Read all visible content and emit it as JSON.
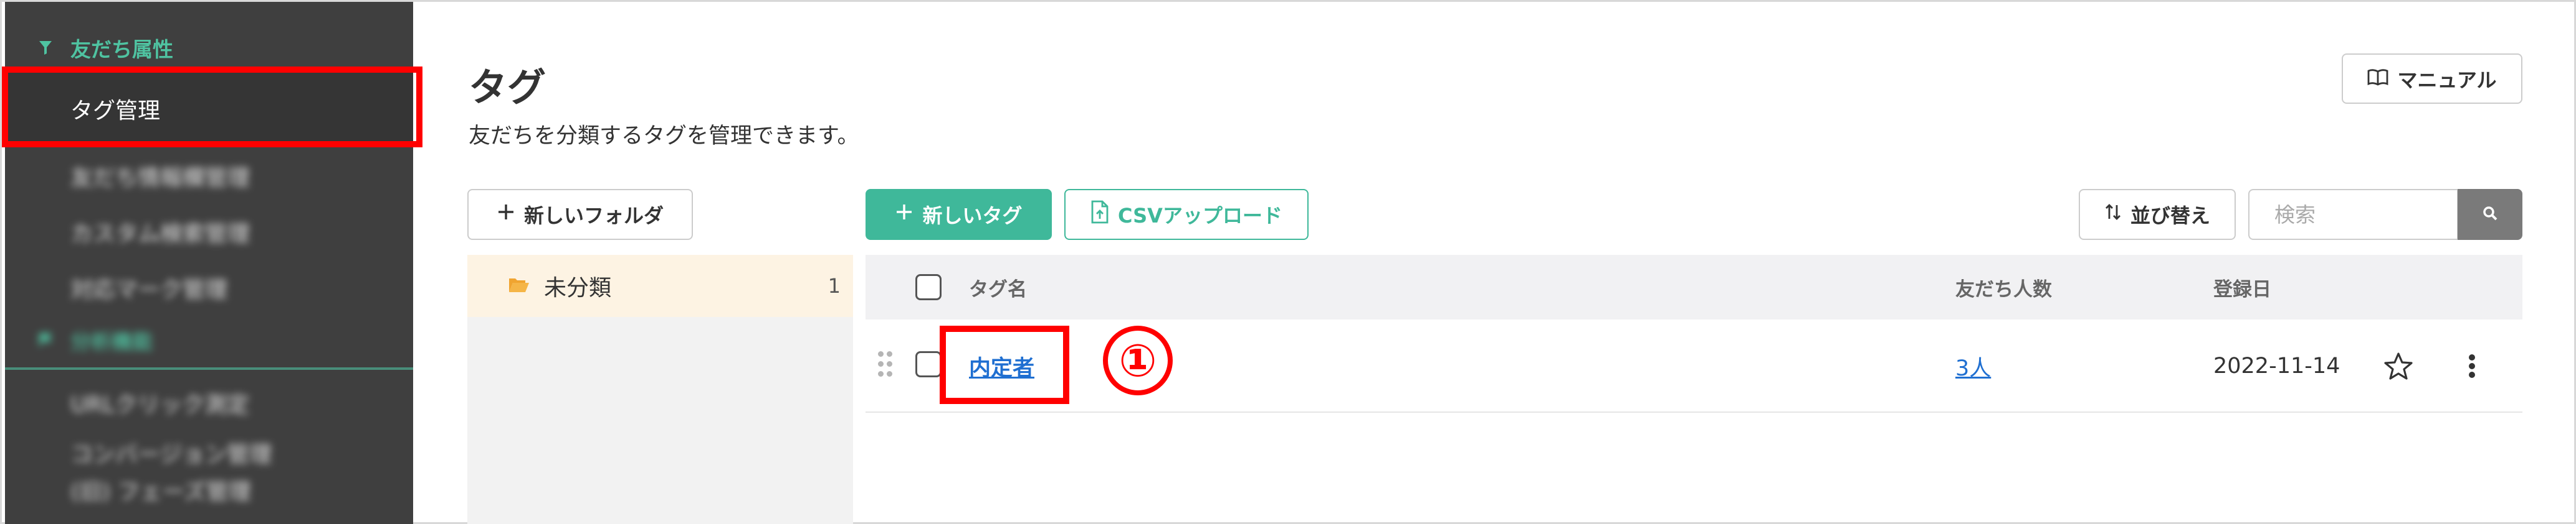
{
  "sidebar": {
    "section1_label": "友だち属性",
    "active_item": "タグ管理",
    "blurred_items": [
      "友だち情報欄管理",
      "カスタム検索管理",
      "対応マーク管理"
    ],
    "section2_label": "分析機能",
    "blurred_items2": [
      "URLクリック測定",
      "コンバージョン管理",
      "(旧) フェーズ管理"
    ]
  },
  "page": {
    "title": "タグ",
    "description": "友だちを分類するタグを管理できます。",
    "manual_label": "マニュアル"
  },
  "toolbar": {
    "new_folder_label": "新しいフォルダ",
    "new_tag_label": "新しいタグ",
    "csv_upload_label": "CSVアップロード",
    "sort_label": "並び替え",
    "search_placeholder": "検索"
  },
  "folders": [
    {
      "name": "未分類",
      "count": "1"
    }
  ],
  "table": {
    "headers": {
      "tag_name": "タグ名",
      "friends": "友だち人数",
      "registered": "登録日"
    },
    "rows": [
      {
        "tag_name": "内定者",
        "friends": "3人",
        "registered": "2022-11-14"
      }
    ]
  },
  "annotation": {
    "step_number": "①"
  },
  "colors": {
    "accent_green": "#3fb89a",
    "sidebar_bg": "#3f3f3f",
    "highlight_red": "#ff0000",
    "link_blue": "#1f6fd1"
  }
}
